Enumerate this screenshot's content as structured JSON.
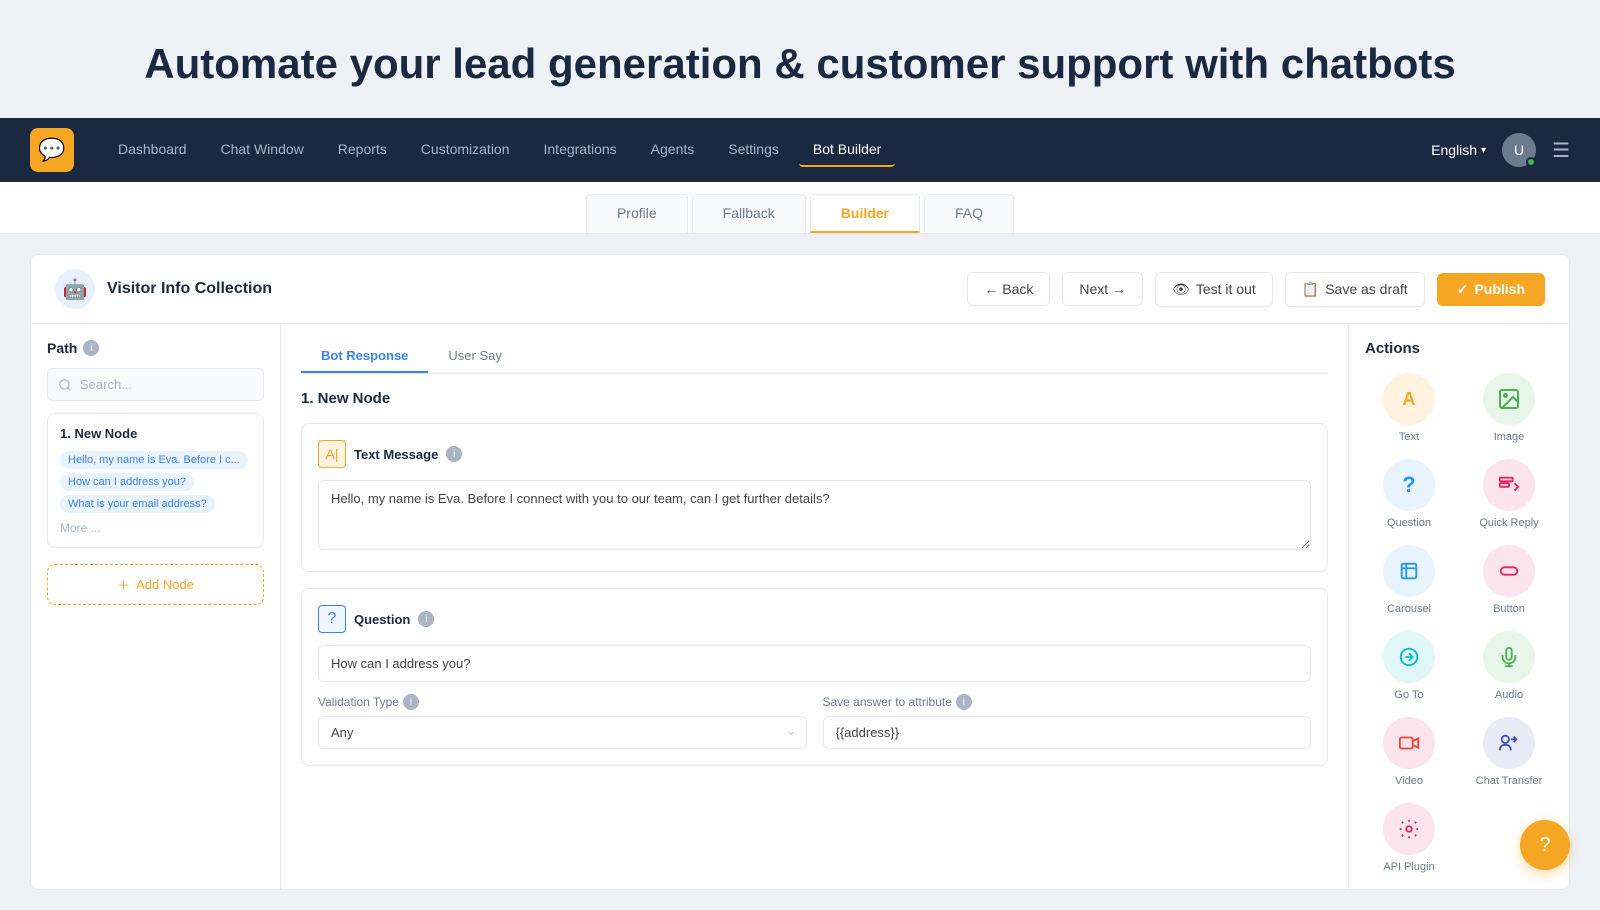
{
  "hero": {
    "title": "Automate your lead generation & customer support with chatbots"
  },
  "navbar": {
    "logo_icon": "💬",
    "links": [
      {
        "id": "dashboard",
        "label": "Dashboard",
        "active": false
      },
      {
        "id": "chat-window",
        "label": "Chat Window",
        "active": false
      },
      {
        "id": "reports",
        "label": "Reports",
        "active": false
      },
      {
        "id": "customization",
        "label": "Customization",
        "active": false
      },
      {
        "id": "integrations",
        "label": "Integrations",
        "active": false
      },
      {
        "id": "agents",
        "label": "Agents",
        "active": false
      },
      {
        "id": "settings",
        "label": "Settings",
        "active": false
      },
      {
        "id": "bot-builder",
        "label": "Bot Builder",
        "active": true
      }
    ],
    "language": "English",
    "avatar_initials": "U"
  },
  "sub_tabs": [
    {
      "id": "profile",
      "label": "Profile",
      "active": false
    },
    {
      "id": "fallback",
      "label": "Fallback",
      "active": false
    },
    {
      "id": "builder",
      "label": "Builder",
      "active": true
    },
    {
      "id": "faq",
      "label": "FAQ",
      "active": false
    }
  ],
  "builder": {
    "bot_title": "Visitor Info Collection",
    "bot_avatar": "🤖",
    "back_label": "← Back",
    "next_label": "Next →",
    "test_label": "Test it out",
    "draft_label": "Save as draft",
    "publish_label": "Publish"
  },
  "path": {
    "title": "Path",
    "search_placeholder": "Search...",
    "node": {
      "title": "1. New Node",
      "tags": [
        "Hello, my name is Eva. Before I c...",
        "How can I address you?",
        "What is your email address?"
      ],
      "more_label": "More ..."
    },
    "add_node_label": "Add Node"
  },
  "editor": {
    "tabs": [
      {
        "id": "bot-response",
        "label": "Bot Response",
        "active": true
      },
      {
        "id": "user-say",
        "label": "User Say",
        "active": false
      }
    ],
    "node_label": "1.  New Node",
    "text_message": {
      "icon": "A|",
      "label": "Text Message",
      "content": "Hello, my name is Eva. Before I connect with you to our team, can I get further details?"
    },
    "question": {
      "icon": "?",
      "label": "Question",
      "content": "How can I address you?",
      "validation_label": "Validation Type",
      "validation_info": "i",
      "validation_value": "Any",
      "save_answer_label": "Save answer to attribute",
      "save_answer_info": "i",
      "save_answer_value": "{{address}}"
    }
  },
  "actions": {
    "title": "Actions",
    "items": [
      {
        "id": "text",
        "label": "Text",
        "icon": "A",
        "color_class": "icon-text"
      },
      {
        "id": "image",
        "label": "Image",
        "icon": "🖼",
        "color_class": "icon-image"
      },
      {
        "id": "question",
        "label": "Question",
        "icon": "?",
        "color_class": "icon-question"
      },
      {
        "id": "quick-reply",
        "label": "Quick Reply",
        "icon": "≡→",
        "color_class": "icon-quickreply"
      },
      {
        "id": "carousel",
        "label": "Carousel",
        "icon": "⊞",
        "color_class": "icon-carousel"
      },
      {
        "id": "button",
        "label": "Button",
        "icon": "▬",
        "color_class": "icon-button"
      },
      {
        "id": "go-to",
        "label": "Go To",
        "icon": "↗",
        "color_class": "icon-goto"
      },
      {
        "id": "audio",
        "label": "Audio",
        "icon": "🎙",
        "color_class": "icon-audio"
      },
      {
        "id": "video",
        "label": "Video",
        "icon": "📹",
        "color_class": "icon-video"
      },
      {
        "id": "chat-transfer",
        "label": "Chat Transfer",
        "icon": "👤→",
        "color_class": "icon-chattransfer"
      },
      {
        "id": "api-plugin",
        "label": "API Plugin",
        "icon": "⚙",
        "color_class": "icon-apiplugin"
      }
    ]
  },
  "help": {
    "icon": "?"
  }
}
